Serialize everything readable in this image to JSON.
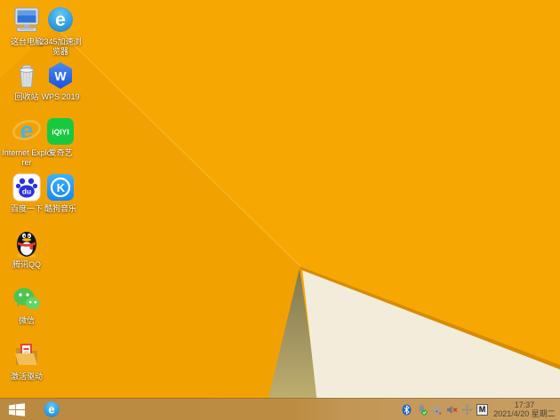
{
  "wallpaper": {
    "colors": {
      "base": "#F7A701",
      "shade": "#E08E00",
      "highlight_line": "#FFC94F",
      "ridge": "#D78C00",
      "cream": "#F2EDDB",
      "olive_top": "#83784F",
      "olive_bottom": "#C7B674"
    }
  },
  "desktop": {
    "icons": [
      {
        "id": "this-pc",
        "label": "这台电脑"
      },
      {
        "id": "browser-2345",
        "label": "2345加速浏览器",
        "icon_text": "e"
      },
      {
        "id": "recycle-bin",
        "label": "回收站"
      },
      {
        "id": "wps-2019",
        "label": "WPS 2019",
        "icon_text": "W"
      },
      {
        "id": "internet-explorer",
        "label": "Internet Explorer",
        "icon_text": "e"
      },
      {
        "id": "iqiyi",
        "label": "爱奇艺",
        "icon_text": "iQIYI"
      },
      {
        "id": "baidu",
        "label": "百度一下",
        "icon_text": "du"
      },
      {
        "id": "kugou-music",
        "label": "酷狗音乐",
        "icon_text": "K"
      },
      {
        "id": "tencent-qq",
        "label": "腾讯QQ"
      },
      {
        "id": "wechat",
        "label": "微信"
      },
      {
        "id": "driver-tools",
        "label": "激活驱动"
      }
    ]
  },
  "taskbar": {
    "colors": {
      "background": "#BD8C43",
      "clock_text": "#4F4433"
    },
    "pinned": [
      {
        "id": "browser-2345",
        "icon_text": "e"
      }
    ],
    "tray": [
      {
        "name": "bluetooth"
      },
      {
        "name": "safely-remove-hardware"
      },
      {
        "name": "security-lock"
      },
      {
        "name": "volume-muted"
      },
      {
        "name": "move-tool"
      },
      {
        "name": "input-method",
        "glyph": "M"
      }
    ],
    "clock": {
      "time": "17:37",
      "date": "2021/4/20 星期二"
    }
  }
}
